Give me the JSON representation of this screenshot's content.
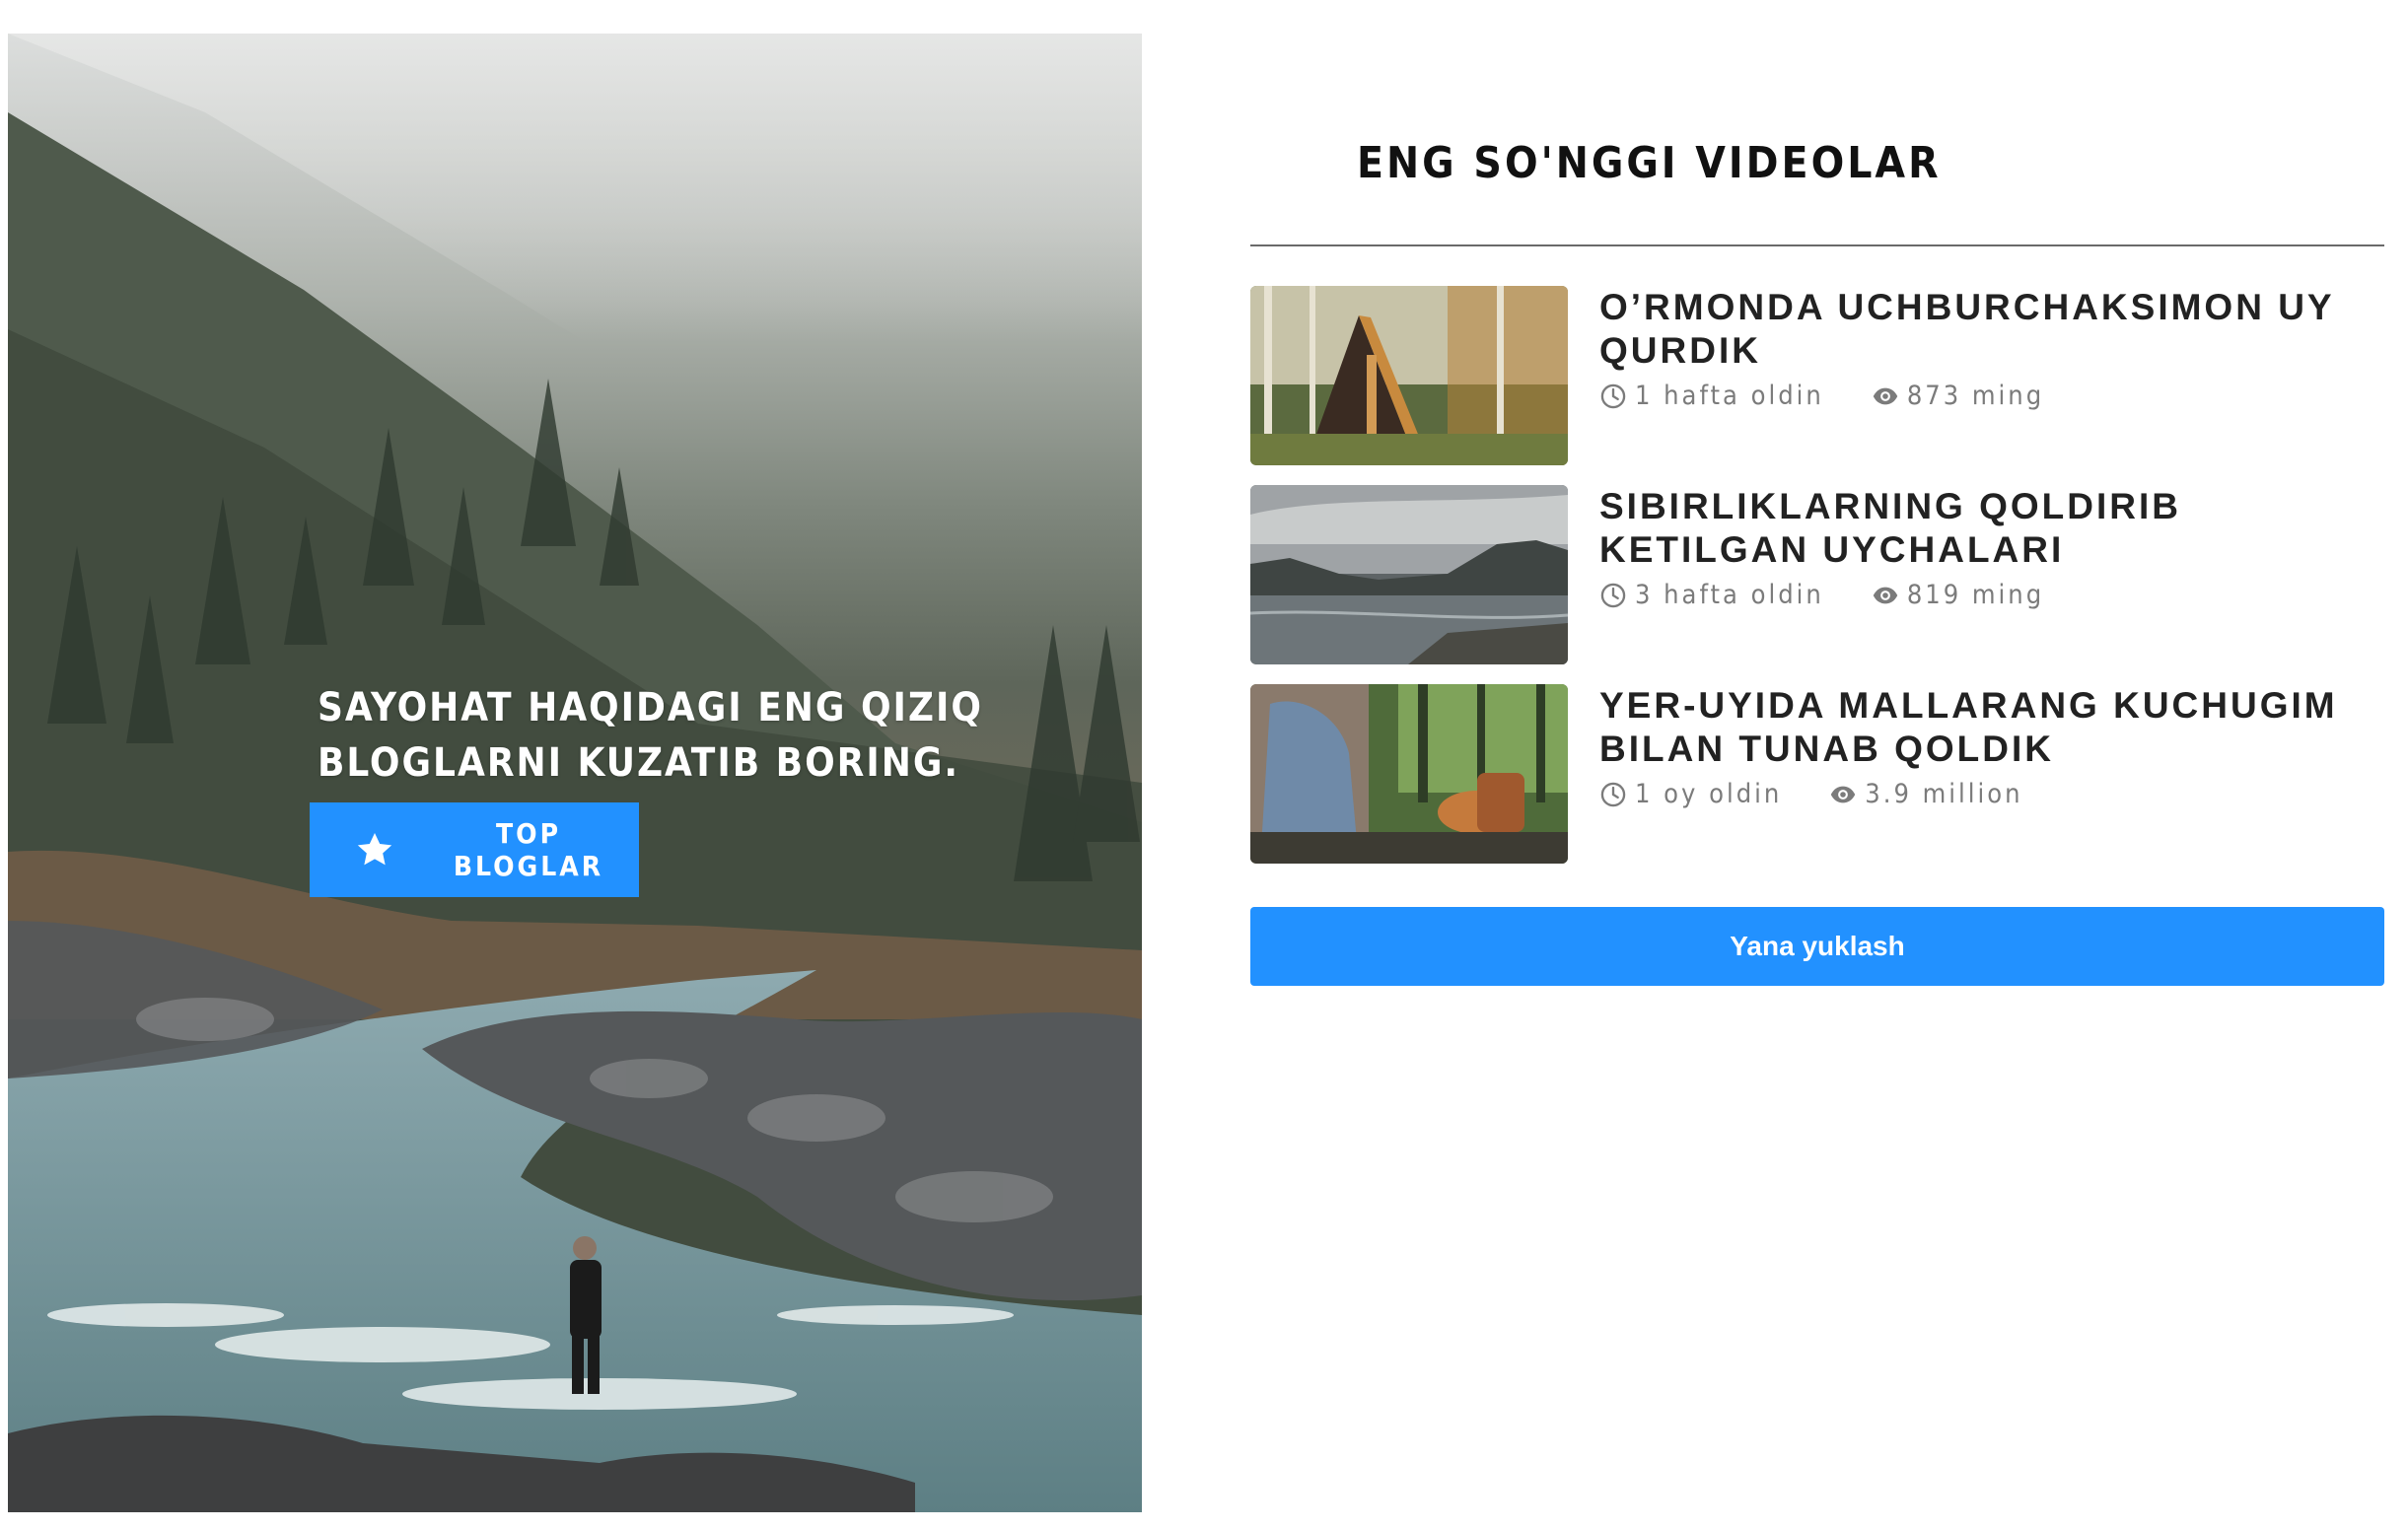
{
  "hero": {
    "headline": "SAYOHAT HAQIDAGI ENG QIZIQ\nBLOGLARNI KUZATIB BORING.",
    "cta_label": "TOP BLOGLAR"
  },
  "latest": {
    "title": "ENG SO'NGGI VIDEOLAR",
    "videos": [
      {
        "title": "O’RMONDA UCHBURCHAKSIMON UY QURDIK",
        "time": "1 hafta oldin",
        "views": "873 ming"
      },
      {
        "title": "SIBIRLIKLARNING QOLDIRIB KETILGAN UYCHALARI",
        "time": "3 hafta oldin",
        "views": "819 ming"
      },
      {
        "title": "YER-UYIDA MALLARANG KUCHUGIM BILAN TUNAB QOLDIK",
        "time": "1 oy oldin",
        "views": "3.9 million"
      }
    ],
    "load_more": "Yana yuklash"
  },
  "colors": {
    "accent": "#2291ff",
    "text": "#222222",
    "meta": "#7b7b7b"
  },
  "icons": {
    "cta": "star-icon",
    "time": "clock-icon",
    "views": "eye-icon"
  }
}
